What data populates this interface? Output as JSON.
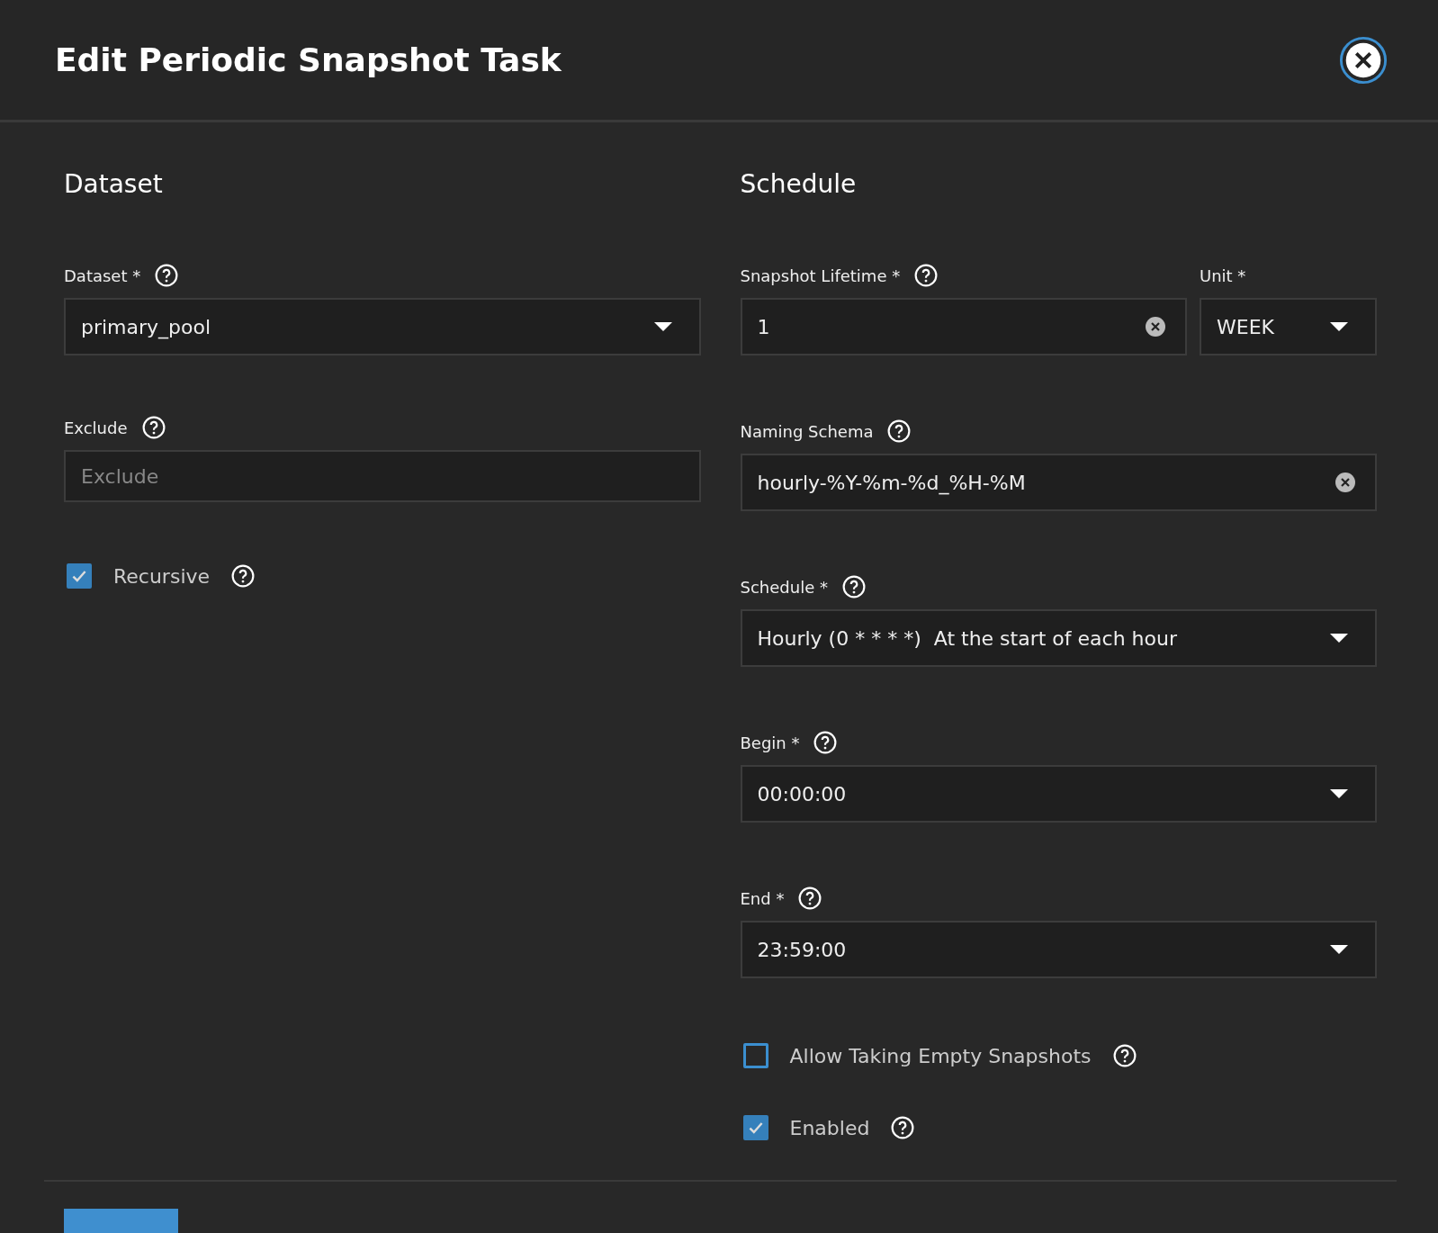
{
  "title": "Edit Periodic Snapshot Task",
  "left": {
    "heading": "Dataset",
    "fields": [
      {
        "kind": "select",
        "label": "Dataset *",
        "value": "primary_pool"
      },
      {
        "kind": "input",
        "label": "Exclude",
        "placeholder": "Exclude"
      },
      {
        "kind": "checkbox",
        "label": "Recursive",
        "checked": true
      }
    ]
  },
  "right": {
    "heading": "Schedule",
    "lifetime": {
      "label": "Snapshot Lifetime *",
      "value": "1"
    },
    "unit": {
      "label": "Unit *",
      "value": "WEEK"
    },
    "fields": [
      {
        "kind": "clearable",
        "label": "Naming Schema",
        "value": "hourly-%Y-%m-%d_%H-%M"
      },
      {
        "kind": "select",
        "label": "Schedule *",
        "value": "Hourly (0 * * * *)  At the start of each hour"
      },
      {
        "kind": "select",
        "label": "Begin *",
        "value": "00:00:00"
      },
      {
        "kind": "select",
        "label": "End *",
        "value": "23:59:00"
      },
      {
        "kind": "checkbox",
        "label": "Allow Taking Empty Snapshots",
        "checked": false
      },
      {
        "kind": "checkbox",
        "label": "Enabled",
        "checked": true
      }
    ]
  }
}
